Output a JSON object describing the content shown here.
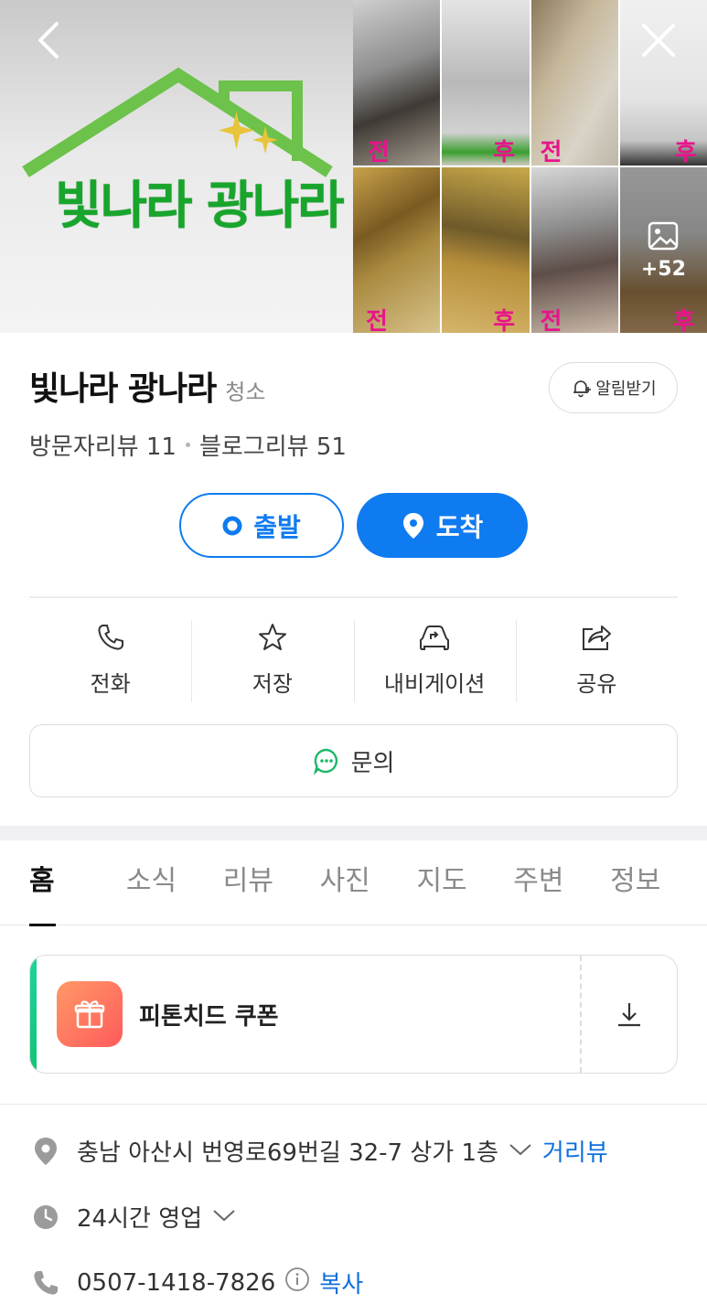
{
  "hero": {
    "logo_text": "빛나라 광나라",
    "photo_tags": [
      "전",
      "후",
      "전",
      "후",
      "전",
      "후",
      "전",
      "후"
    ],
    "more_photos": "+52"
  },
  "place": {
    "name": "빛나라 광나라",
    "category": "청소",
    "notify_label": "알림받기",
    "visitor_reviews": "방문자리뷰 11",
    "blog_reviews": "블로그리뷰 51"
  },
  "route": {
    "start_label": "출발",
    "arrive_label": "도착"
  },
  "actions": [
    {
      "label": "전화",
      "icon": "phone-icon"
    },
    {
      "label": "저장",
      "icon": "star-icon"
    },
    {
      "label": "내비게이션",
      "icon": "car-navigation-icon"
    },
    {
      "label": "공유",
      "icon": "share-icon"
    }
  ],
  "inquiry_label": "문의",
  "tabs": [
    "홈",
    "소식",
    "리뷰",
    "사진",
    "지도",
    "주변",
    "정보"
  ],
  "active_tab": "홈",
  "coupon": {
    "title": "피톤치드 쿠폰"
  },
  "info": {
    "address": "충남 아산시 번영로69번길 32-7 상가 1층",
    "street_view": "거리뷰",
    "hours": "24시간 영업",
    "phone": "0507-1418-7826",
    "copy_label": "복사"
  },
  "colors": {
    "accent": "#0f7bf0",
    "logo_green": "#18a52c",
    "house_green": "#6cc24a",
    "tag_pink": "#e8148b",
    "coupon_green": "#12c377"
  }
}
